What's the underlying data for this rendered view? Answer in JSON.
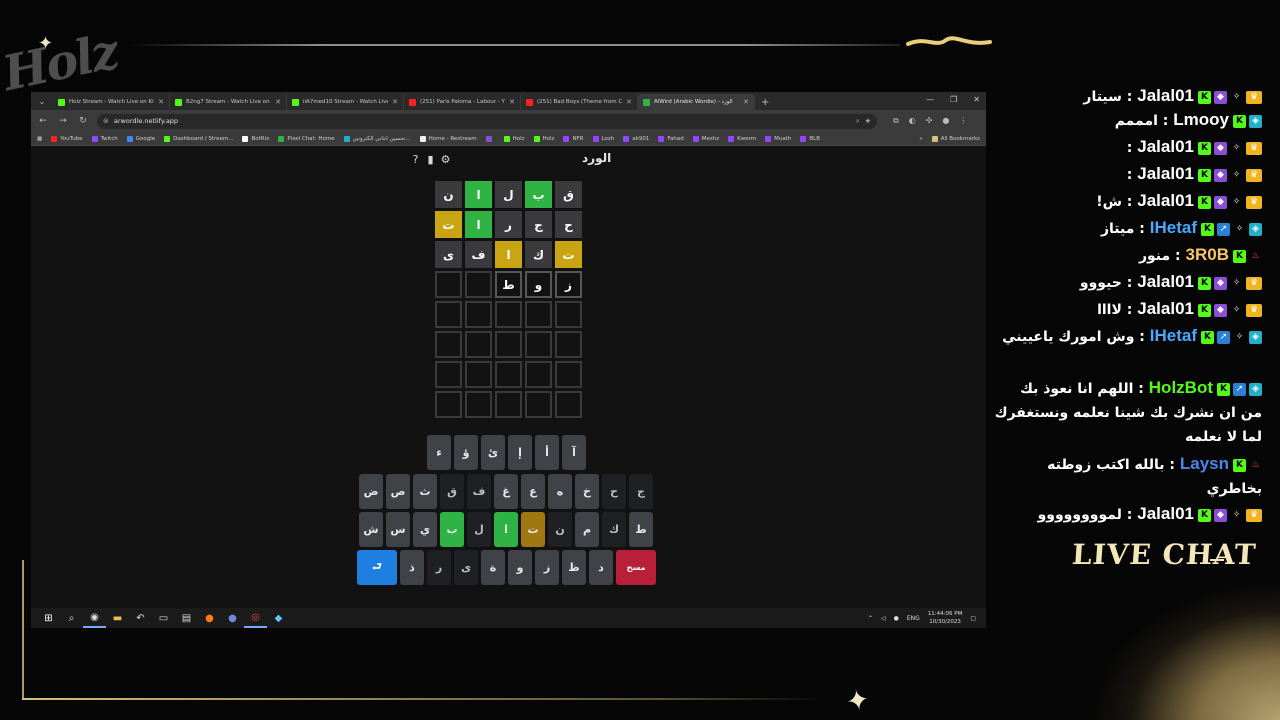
{
  "overlay": {
    "logo_text": "Holz",
    "live_chat_label": "LIVE CHAT"
  },
  "browser": {
    "tabs": [
      {
        "title": "Holz Stream - Watch Live on Ki",
        "fav_color": "#53fc18"
      },
      {
        "title": "B2ng7 Stream - Watch Live on",
        "fav_color": "#53fc18"
      },
      {
        "title": "iiA7med10 Stream - Watch Live",
        "fav_color": "#53fc18"
      },
      {
        "title": "(251) Paris Paloma - Labour - Y",
        "fav_color": "#ff2020"
      },
      {
        "title": "(251) Bad Boys (Theme from Co",
        "fav_color": "#ff2020"
      },
      {
        "title": "AlWird (Arabic Wordle) - الورد",
        "fav_color": "#2fb344",
        "active": true
      }
    ],
    "url": "arwordle.netlify.app",
    "bookmarks": [
      {
        "label": "YouTube",
        "color": "#ff2020"
      },
      {
        "label": "Twitch",
        "color": "#9146ff"
      },
      {
        "label": "Google",
        "color": "#4285f4"
      },
      {
        "label": "Dashboard / Stream...",
        "color": "#53fc18"
      },
      {
        "label": "BotRix",
        "color": "#ffffff"
      },
      {
        "label": "Pixel Chat: Home",
        "color": "#2fb344"
      },
      {
        "label": "تحسين انتاني الكترونين...",
        "color": "#20b0c8"
      },
      {
        "label": "Home - Restream",
        "color": "#eeeeee"
      },
      {
        "label": "",
        "color": "#8a4fd6"
      },
      {
        "label": "Holz",
        "color": "#53fc18"
      },
      {
        "label": "Holz",
        "color": "#53fc18"
      },
      {
        "label": "NFR",
        "color": "#9146ff"
      },
      {
        "label": "Lozh",
        "color": "#9146ff"
      },
      {
        "label": "ak901",
        "color": "#9146ff"
      },
      {
        "label": "Fahad",
        "color": "#9146ff"
      },
      {
        "label": "Meshz",
        "color": "#9146ff"
      },
      {
        "label": "Kwerm",
        "color": "#9146ff"
      },
      {
        "label": "Muath",
        "color": "#9146ff"
      },
      {
        "label": "BLB",
        "color": "#9146ff"
      }
    ],
    "all_bookmarks": "All Bookmarks"
  },
  "game": {
    "title": "الورد",
    "board": [
      [
        {
          "l": "ق",
          "s": "absent"
        },
        {
          "l": "ب",
          "s": "correct"
        },
        {
          "l": "ل",
          "s": "absent"
        },
        {
          "l": "ا",
          "s": "correct"
        },
        {
          "l": "ن",
          "s": "absent"
        }
      ],
      [
        {
          "l": "ح",
          "s": "absent"
        },
        {
          "l": "ج",
          "s": "absent"
        },
        {
          "l": "ر",
          "s": "absent"
        },
        {
          "l": "ا",
          "s": "correct"
        },
        {
          "l": "ت",
          "s": "present"
        }
      ],
      [
        {
          "l": "ت",
          "s": "present"
        },
        {
          "l": "ك",
          "s": "absent"
        },
        {
          "l": "ا",
          "s": "present"
        },
        {
          "l": "ف",
          "s": "absent"
        },
        {
          "l": "ى",
          "s": "absent"
        }
      ],
      [
        {
          "l": "ز",
          "s": "filled"
        },
        {
          "l": "و",
          "s": "filled"
        },
        {
          "l": "ط",
          "s": "filled"
        },
        {
          "l": "",
          "s": "empty"
        },
        {
          "l": "",
          "s": "empty"
        }
      ],
      [
        {
          "l": "",
          "s": "empty"
        },
        {
          "l": "",
          "s": "empty"
        },
        {
          "l": "",
          "s": "empty"
        },
        {
          "l": "",
          "s": "empty"
        },
        {
          "l": "",
          "s": "empty"
        }
      ],
      [
        {
          "l": "",
          "s": "empty"
        },
        {
          "l": "",
          "s": "empty"
        },
        {
          "l": "",
          "s": "empty"
        },
        {
          "l": "",
          "s": "empty"
        },
        {
          "l": "",
          "s": "empty"
        }
      ],
      [
        {
          "l": "",
          "s": "empty"
        },
        {
          "l": "",
          "s": "empty"
        },
        {
          "l": "",
          "s": "empty"
        },
        {
          "l": "",
          "s": "empty"
        },
        {
          "l": "",
          "s": "empty"
        }
      ],
      [
        {
          "l": "",
          "s": "empty"
        },
        {
          "l": "",
          "s": "empty"
        },
        {
          "l": "",
          "s": "empty"
        },
        {
          "l": "",
          "s": "empty"
        },
        {
          "l": "",
          "s": "empty"
        }
      ]
    ],
    "keyboard": {
      "row1": [
        {
          "k": "آ"
        },
        {
          "k": "أ"
        },
        {
          "k": "إ"
        },
        {
          "k": "ئ"
        },
        {
          "k": "ؤ"
        },
        {
          "k": "ء"
        }
      ],
      "row2": [
        {
          "k": "ج",
          "s": "absent"
        },
        {
          "k": "ح",
          "s": "absent"
        },
        {
          "k": "خ"
        },
        {
          "k": "ه"
        },
        {
          "k": "ع"
        },
        {
          "k": "غ"
        },
        {
          "k": "ف",
          "s": "absent"
        },
        {
          "k": "ق",
          "s": "absent"
        },
        {
          "k": "ث"
        },
        {
          "k": "ص"
        },
        {
          "k": "ض"
        }
      ],
      "row3": [
        {
          "k": "ط"
        },
        {
          "k": "ك",
          "s": "absent"
        },
        {
          "k": "م"
        },
        {
          "k": "ن",
          "s": "absent"
        },
        {
          "k": "ت",
          "s": "present"
        },
        {
          "k": "ا",
          "s": "correct"
        },
        {
          "k": "ل",
          "s": "absent"
        },
        {
          "k": "ب",
          "s": "correct"
        },
        {
          "k": "ي"
        },
        {
          "k": "س"
        },
        {
          "k": "ش"
        }
      ],
      "row4": [
        {
          "k": "مسح",
          "s": "del"
        },
        {
          "k": "د"
        },
        {
          "k": "ظ"
        },
        {
          "k": "ز"
        },
        {
          "k": "و"
        },
        {
          "k": "ة"
        },
        {
          "k": "ى",
          "s": "absent"
        },
        {
          "k": "ر",
          "s": "absent"
        },
        {
          "k": "ذ"
        },
        {
          "k": "⮐",
          "s": "enter"
        }
      ]
    }
  },
  "taskbar": {
    "lang": "ENG",
    "time": "11:44:06 PM",
    "date": "10/30/2023"
  },
  "chat": [
    {
      "user": "Jalal01",
      "color": "#ffffff",
      "badges": [
        "k",
        "cube",
        "sparkle",
        "crown"
      ],
      "text": "سيتار"
    },
    {
      "user": "Lmooy",
      "color": "#ffffff",
      "badges": [
        "k",
        "teal"
      ],
      "text": "امممم"
    },
    {
      "user": "Jalal01",
      "color": "#ffffff",
      "badges": [
        "k",
        "cube",
        "sparkle",
        "crown"
      ],
      "text": ""
    },
    {
      "user": "Jalal01",
      "color": "#ffffff",
      "badges": [
        "k",
        "cube",
        "sparkle",
        "crown"
      ],
      "text": ""
    },
    {
      "user": "Jalal01",
      "color": "#ffffff",
      "badges": [
        "k",
        "cube",
        "sparkle",
        "crown"
      ],
      "text": "ش!"
    },
    {
      "user": "IHetaf",
      "color": "#4aa8ff",
      "badges": [
        "k",
        "blue",
        "sparkle",
        "teal"
      ],
      "text": "ميتاز"
    },
    {
      "user": "3R0B",
      "color": "#f7c46c",
      "badges": [
        "k",
        "fire"
      ],
      "text": "منور"
    },
    {
      "user": "Jalal01",
      "color": "#ffffff",
      "badges": [
        "k",
        "cube",
        "sparkle",
        "crown"
      ],
      "text": "حيووو"
    },
    {
      "user": "Jalal01",
      "color": "#ffffff",
      "badges": [
        "k",
        "cube",
        "sparkle",
        "crown"
      ],
      "text": "لاااا"
    },
    {
      "user": "IHetaf",
      "color": "#4aa8ff",
      "badges": [
        "k",
        "blue",
        "sparkle",
        "teal"
      ],
      "text": "وش امورك ياعييني"
    },
    {
      "user": "HolzBot",
      "color": "#53fc18",
      "badges": [
        "k",
        "blue",
        "teal"
      ],
      "text": "اللهم انا نعوذ بك من ان نشرك بك شينا نعلمه ونستغفرك لما لا نعلمه"
    },
    {
      "user": "Laysn",
      "color": "#4a86e8",
      "badges": [
        "k",
        "fire"
      ],
      "text": "بالله اكتب زوطته بخاطري"
    },
    {
      "user": "Jalal01",
      "color": "#ffffff",
      "badges": [
        "k",
        "cube",
        "sparkle",
        "crown"
      ],
      "text": "لموووووووو"
    }
  ]
}
